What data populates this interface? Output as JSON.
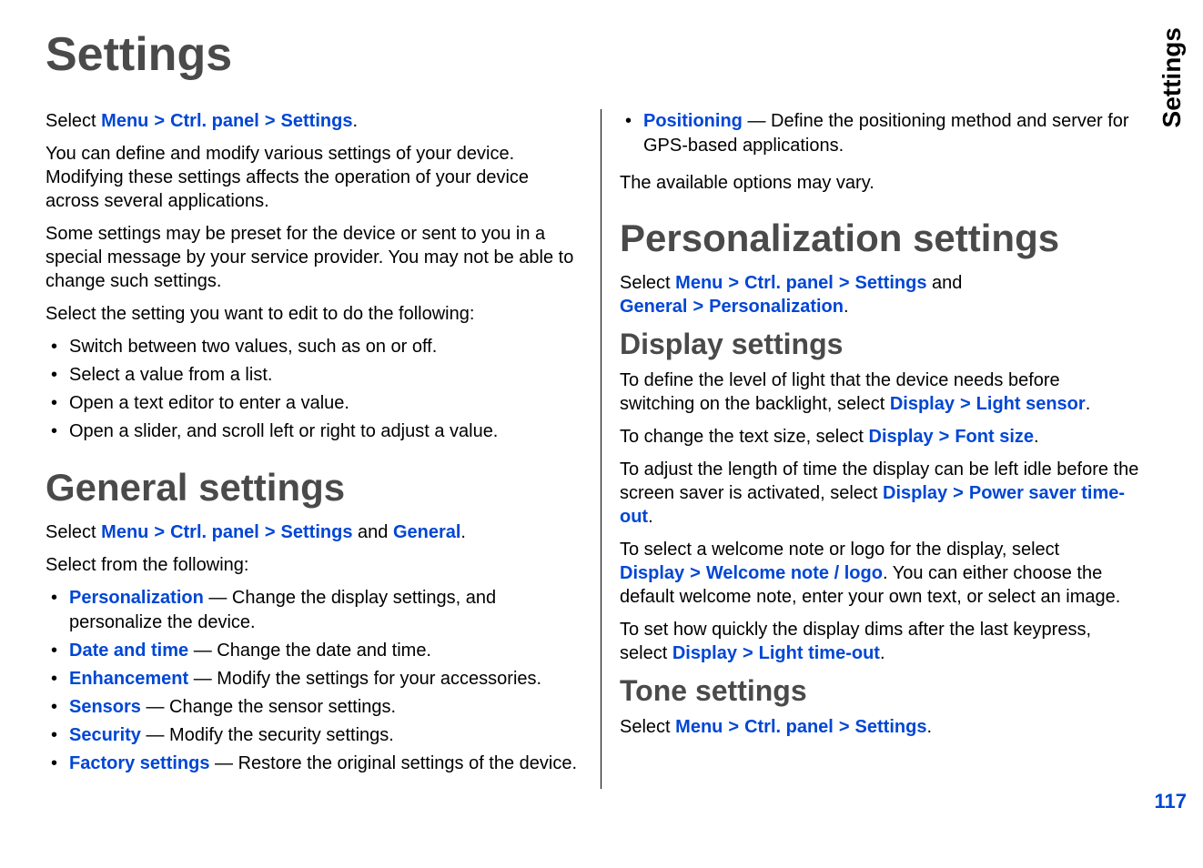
{
  "sideLabel": "Settings",
  "pageNumber": "117",
  "title": "Settings",
  "left": {
    "navSelect": "Select ",
    "nav1": "Menu",
    "nav2": "Ctrl. panel",
    "nav3": "Settings",
    "navPeriod": ".",
    "intro1": "You can define and modify various settings of your device. Modifying these settings affects the operation of your device across several applications.",
    "intro2": "Some settings may be preset for the device or sent to you in a special message by your service provider. You may not be able to change such settings.",
    "intro3": "Select the setting you want to edit to do the following:",
    "bullets": [
      "Switch between two values, such as on or off.",
      "Select a value from a list.",
      "Open a text editor to enter a value.",
      "Open a slider, and scroll left or right to adjust a value."
    ],
    "generalTitle": "General settings",
    "genNavSelect": "Select ",
    "genNav1": "Menu",
    "genNav2": "Ctrl. panel",
    "genNav3": "Settings",
    "genAnd": " and ",
    "genNav4": "General",
    "genPeriod": ".",
    "selectFrom": "Select from the following:",
    "genItems": [
      {
        "link": "Personalization",
        "text": " — Change the display settings, and personalize the device."
      },
      {
        "link": "Date and time",
        "text": " — Change the date and time."
      },
      {
        "link": "Enhancement",
        "text": " — Modify the settings for your accessories."
      },
      {
        "link": "Sensors",
        "text": " — Change the sensor settings."
      },
      {
        "link": "Security",
        "text": " — Modify the security settings."
      },
      {
        "link": "Factory settings",
        "text": " — Restore the original settings of the device."
      }
    ]
  },
  "right": {
    "posItem": {
      "link": "Positioning",
      "text": " — Define the positioning method and server for GPS-based applications."
    },
    "optsVary": "The available options may vary.",
    "persTitle": "Personalization settings",
    "persNavSelect": "Select ",
    "persNav1": "Menu",
    "persNav2": "Ctrl. panel",
    "persNav3": "Settings",
    "persAnd": " and ",
    "persNav4": "General",
    "persNav5": "Personalization",
    "persPeriod": ".",
    "dispTitle": "Display settings",
    "disp1a": "To define the level of light that the device needs before switching on the backlight, select ",
    "disp1L1": "Display",
    "disp1L2": "Light sensor",
    "disp2a": "To change the text size, select ",
    "disp2L1": "Display",
    "disp2L2": "Font size",
    "disp3a": "To adjust the length of time the display can be left idle before the screen saver is activated, select ",
    "disp3L1": "Display",
    "disp3L2": "Power saver time-out",
    "disp4a": "To select a welcome note or logo for the display, select ",
    "disp4L1": "Display",
    "disp4L2": "Welcome note / logo",
    "disp4b": ". You can either choose the default welcome note, enter your own text, or select an image.",
    "disp5a": "To set how quickly the display dims after the last keypress, select ",
    "disp5L1": "Display",
    "disp5L2": "Light time-out",
    "toneTitle": "Tone settings",
    "toneNavSelect": "Select ",
    "toneNav1": "Menu",
    "toneNav2": "Ctrl. panel",
    "toneNav3": "Settings",
    "tonePeriod": "."
  }
}
